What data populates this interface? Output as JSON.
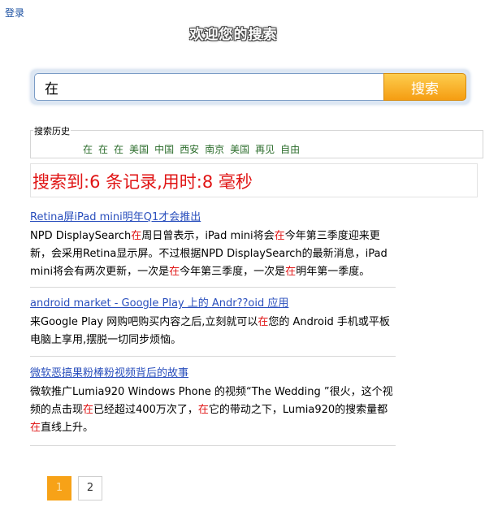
{
  "header": {
    "login_label": "登录",
    "welcome_text": "欢迎您的搜索"
  },
  "search": {
    "value": "在",
    "button_label": "搜索"
  },
  "history": {
    "legend": "搜索历史",
    "items": [
      "在",
      "在",
      "在",
      "美国",
      "中国",
      "西安",
      "南京",
      "美国",
      "再见",
      "自由"
    ]
  },
  "summary": {
    "text": "搜索到:6 条记录,用时:8 毫秒"
  },
  "results": [
    {
      "title": "Retina屏iPad mini明年Q1才会推出",
      "snippet": [
        {
          "t": "NPD DisplaySearch",
          "h": false
        },
        {
          "t": "在",
          "h": true
        },
        {
          "t": "周日曾表示，iPad mini将会",
          "h": false
        },
        {
          "t": "在",
          "h": true
        },
        {
          "t": "今年第三季度迎来更新，会采用Retina显示屏。不过根据NPD DisplaySearch的最新消息，iPad mini将会有两次更新，一次是",
          "h": false
        },
        {
          "t": "在",
          "h": true
        },
        {
          "t": "今年第三季度，一次是",
          "h": false
        },
        {
          "t": "在",
          "h": true
        },
        {
          "t": "明年第一季度。",
          "h": false
        }
      ]
    },
    {
      "title": "android market - Google Play 上的 Andr??oid 应用",
      "snippet": [
        {
          "t": "来Google Play 网购吧购买内容之后,立刻就可以",
          "h": false
        },
        {
          "t": "在",
          "h": true
        },
        {
          "t": "您的 Android 手机或平板电脑上享用,摆脱一切同步烦恼。",
          "h": false
        }
      ]
    },
    {
      "title": "微软恶搞果粉棒粉视频背后的故事",
      "snippet": [
        {
          "t": "微软推广Lumia920 Windows Phone 的视频“The Wedding ”很火，这个视频的点击现",
          "h": false
        },
        {
          "t": "在",
          "h": true
        },
        {
          "t": "已经超过400万次了，",
          "h": false
        },
        {
          "t": "在",
          "h": true
        },
        {
          "t": "它的带动之下，Lumia920的搜索量都",
          "h": false
        },
        {
          "t": "在",
          "h": true
        },
        {
          "t": "直线上升。",
          "h": false
        }
      ]
    }
  ],
  "pager": {
    "pages": [
      "1",
      "2"
    ],
    "current": "1"
  },
  "colors": {
    "highlight": "#e01515",
    "link": "#2a4fbd",
    "history_link": "#2d6e2d",
    "button_orange": "#f59d12"
  }
}
